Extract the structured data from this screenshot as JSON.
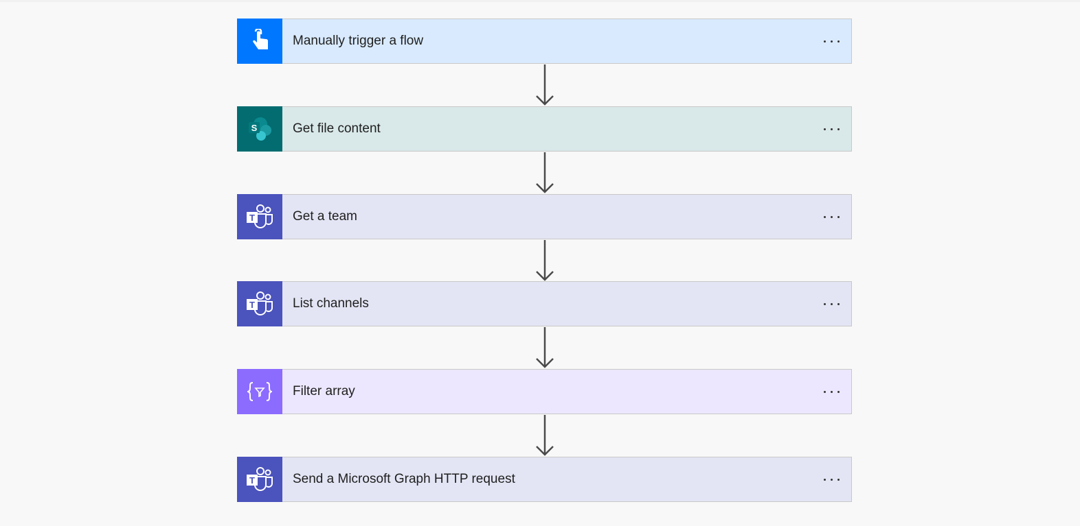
{
  "steps": [
    {
      "title": "Manually trigger a flow",
      "icon": "touch-hand-icon",
      "icon_bg": "#0077ff",
      "card_bg": "#d9eafe"
    },
    {
      "title": "Get file content",
      "icon": "sharepoint-icon",
      "icon_bg": "#036c70",
      "card_bg": "#d9e8e8"
    },
    {
      "title": "Get a team",
      "icon": "teams-icon",
      "icon_bg": "#4b53bc",
      "card_bg": "#e3e5f4"
    },
    {
      "title": "List channels",
      "icon": "teams-icon",
      "icon_bg": "#4b53bc",
      "card_bg": "#e3e5f4"
    },
    {
      "title": "Filter array",
      "icon": "filter-array-icon",
      "icon_bg": "#8c6cff",
      "card_bg": "#ece7fe"
    },
    {
      "title": "Send a Microsoft Graph HTTP request",
      "icon": "teams-icon",
      "icon_bg": "#4b53bc",
      "card_bg": "#e3e5f4"
    }
  ]
}
